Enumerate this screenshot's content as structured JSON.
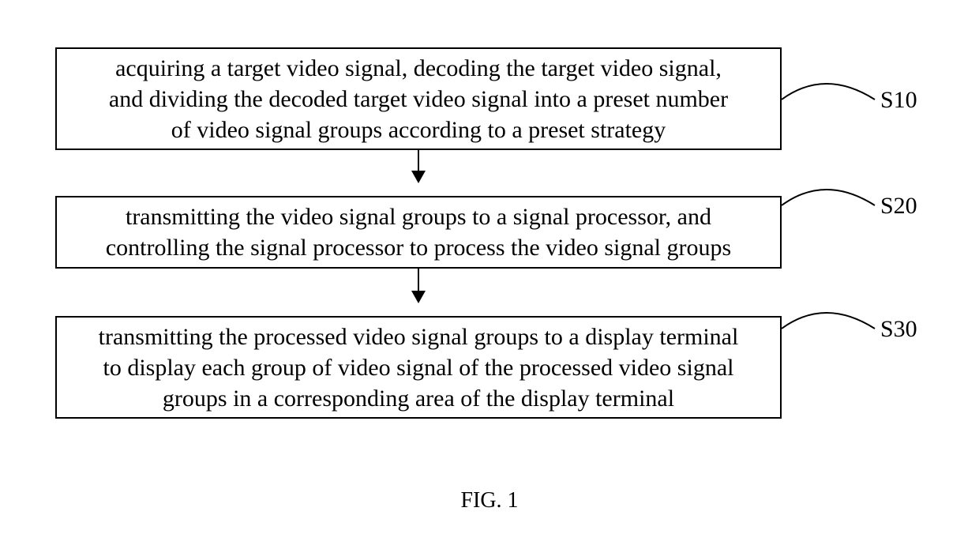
{
  "steps": [
    {
      "id": "s10",
      "label": "S10",
      "text": "acquiring a target video signal, decoding the target video signal,\nand dividing the decoded target video signal into a preset number\nof video signal groups according to a preset strategy"
    },
    {
      "id": "s20",
      "label": "S20",
      "text": "transmitting the video signal groups to a signal processor, and\ncontrolling the signal processor to process the video signal groups"
    },
    {
      "id": "s30",
      "label": "S30",
      "text": "transmitting the processed video signal groups to a display terminal\nto display each group of video signal of the processed video signal\ngroups in a corresponding area of the display terminal"
    }
  ],
  "figure_caption": "FIG. 1"
}
